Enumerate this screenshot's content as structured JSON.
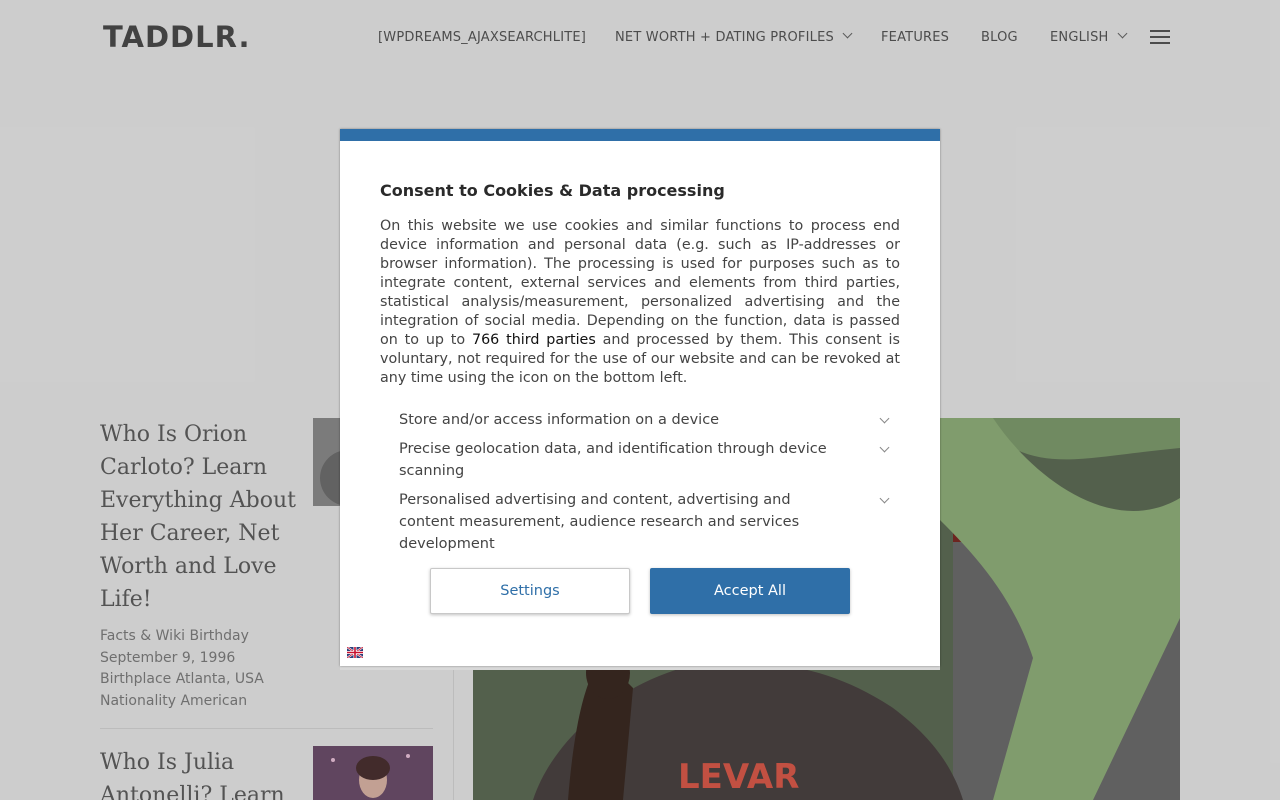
{
  "header": {
    "logo": "TADDLR.",
    "nav": [
      {
        "label": "[WPDREAMS_AJAXSEARCHLITE]",
        "dropdown": false
      },
      {
        "label": "NET WORTH + DATING PROFILES",
        "dropdown": true
      },
      {
        "label": "FEATURES",
        "dropdown": false
      },
      {
        "label": "BLOG",
        "dropdown": false
      },
      {
        "label": "ENGLISH",
        "dropdown": true
      }
    ]
  },
  "articles": [
    {
      "title": "Who Is Orion Carloto? Learn Everything About Her Career, Net Worth and Love Life!",
      "meta": [
        "Facts & Wiki Birthday",
        "September 9, 1996",
        "Birthplace Atlanta, USA",
        "Nationality American"
      ]
    },
    {
      "title": "Who Is Julia Antonelli? Learn"
    }
  ],
  "consent": {
    "title": "Consent to Cookies & Data processing",
    "body_before": "On this website we use cookies and similar functions to process end device information and personal data (e.g. such as IP-addresses or browser information). The processing is used for purposes such as to integrate content, external services and elements from third parties, statistical analysis/measurement, personalized advertising and the integration of social media. Depending on the function, data is passed on to up to ",
    "body_link": "766 third parties",
    "body_after": " and processed by them. This consent is voluntary, not required for the use of our website and can be revoked at any time using the icon on the bottom left.",
    "purposes": [
      "Store and/or access information on a device",
      "Precise geolocation data, and identification through device scanning",
      "Personalised advertising and content, advertising and content measurement, audience research and services development"
    ],
    "settings_label": "Settings",
    "accept_label": "Accept All"
  },
  "colors": {
    "accent": "#2f6fa8",
    "background": "#e5e5e5"
  },
  "icons": [
    "menu-icon",
    "chevron-down-icon",
    "language-flag-icon"
  ]
}
